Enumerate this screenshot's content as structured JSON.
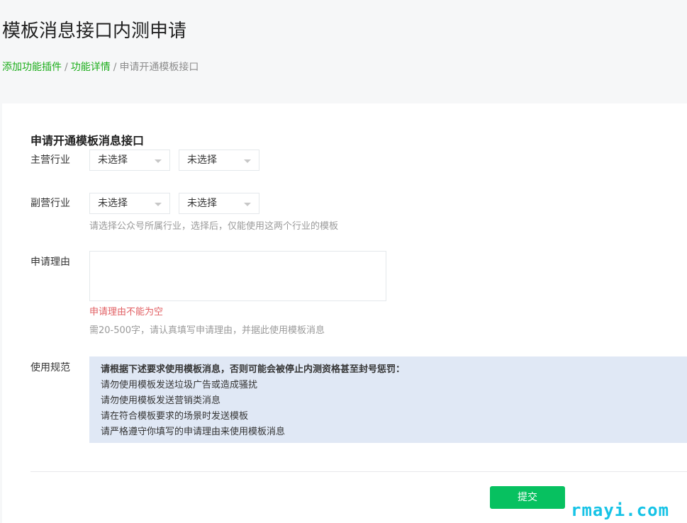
{
  "page": {
    "title": "模板消息接口内测申请"
  },
  "breadcrumb": {
    "items": [
      {
        "label": "添加功能插件",
        "link": true
      },
      {
        "label": "功能详情",
        "link": true
      },
      {
        "label": "申请开通模板接口",
        "link": false
      }
    ],
    "separator": "/"
  },
  "form": {
    "section_title": "申请开通模板消息接口",
    "primary_industry": {
      "label": "主营行业",
      "select1_value": "未选择",
      "select2_value": "未选择"
    },
    "secondary_industry": {
      "label": "副营行业",
      "select1_value": "未选择",
      "select2_value": "未选择",
      "tip": "请选择公众号所属行业，选择后，仅能使用这两个行业的模板"
    },
    "reason": {
      "label": "申请理由",
      "value": "",
      "error": "申请理由不能为空",
      "tip": "需20-500字，请认真填写申请理由，并据此使用模板消息"
    },
    "rules": {
      "label": "使用规范",
      "heading": "请根据下述要求使用模板消息，否则可能会被停止内测资格甚至封号惩罚：",
      "items": [
        "请勿使用模板发送垃圾广告或造成骚扰",
        "请勿使用模板发送营销类消息",
        "请在符合模板要求的场景时发送模板",
        "请严格遵守你填写的申请理由来使用模板消息"
      ]
    },
    "submit_label": "提交"
  },
  "watermark": "rmayi.com",
  "colors": {
    "link_green": "#1aad19",
    "button_green": "#07c160",
    "error_red": "#e15f63",
    "rules_bg": "#e0e8f5"
  }
}
